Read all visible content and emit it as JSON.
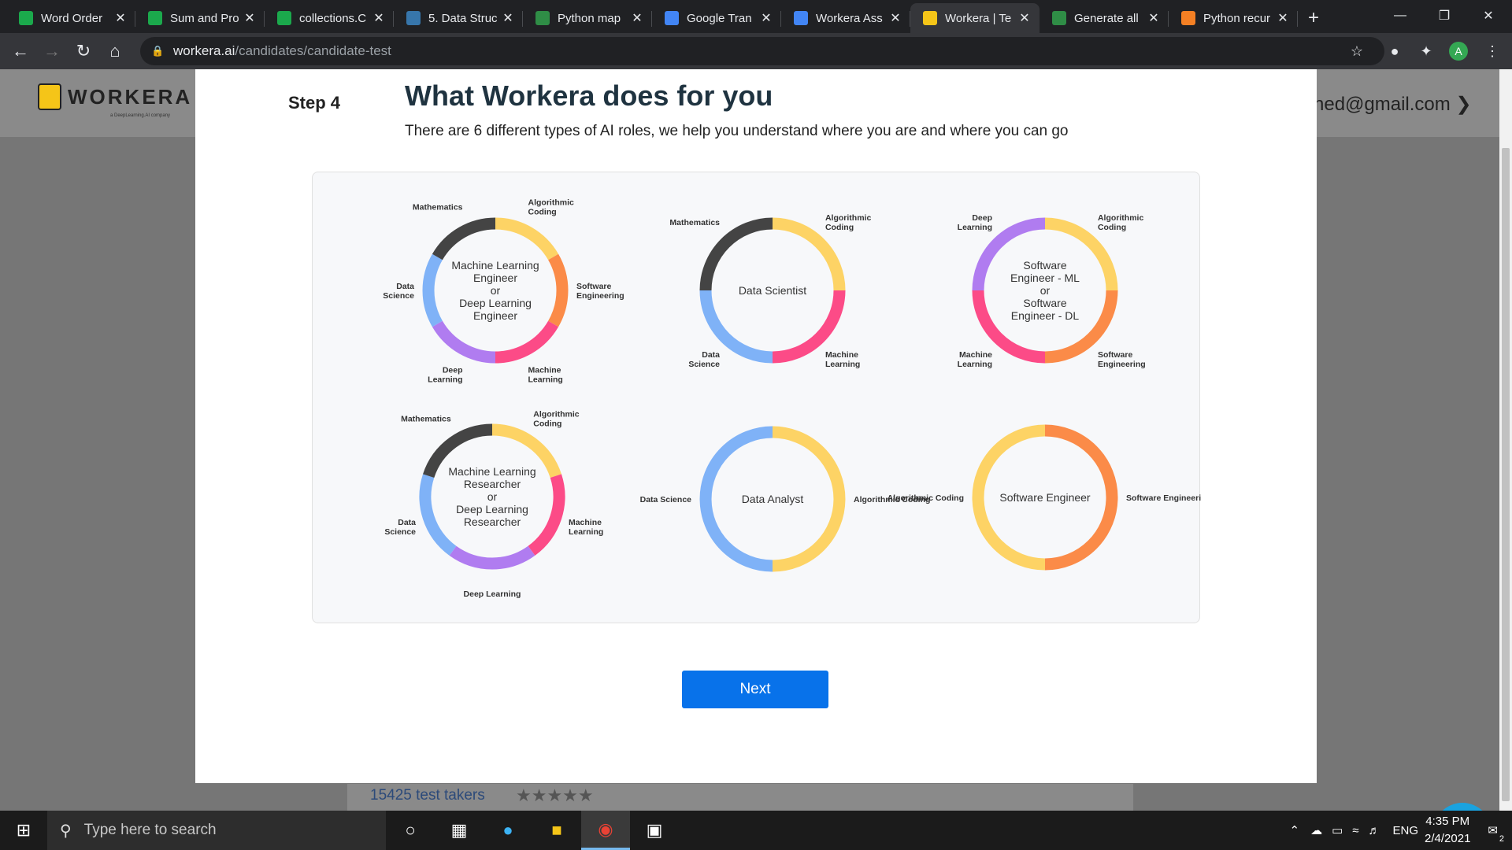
{
  "browser": {
    "tabs": [
      {
        "title": "Word Order",
        "fav": "hackerrank-icon",
        "color": "#1ba94c"
      },
      {
        "title": "Sum and Pro",
        "fav": "hackerrank-icon",
        "color": "#1ba94c"
      },
      {
        "title": "collections.C",
        "fav": "hackerrank-icon",
        "color": "#1ba94c"
      },
      {
        "title": "5. Data Struc",
        "fav": "python-icon",
        "color": "#3776ab"
      },
      {
        "title": "Python map",
        "fav": "geeksforgeeks-icon",
        "color": "#2f8d46"
      },
      {
        "title": "Google Tran",
        "fav": "google-translate-icon",
        "color": "#4285f4"
      },
      {
        "title": "Workera Ass",
        "fav": "docs-icon",
        "color": "#4285f4"
      },
      {
        "title": "Workera | Te",
        "fav": "workera-icon",
        "color": "#f5c518"
      },
      {
        "title": "Generate all",
        "fav": "geeksforgeeks-icon",
        "color": "#2f8d46"
      },
      {
        "title": "Python recur",
        "fav": "stackoverflow-icon",
        "color": "#f48024"
      }
    ],
    "active_tab": 7,
    "url_host": "workera.ai",
    "url_path": "/candidates/candidate-test",
    "profile_initial": "A"
  },
  "background": {
    "logo_text": "WORKERA",
    "logo_sub": "a DeepLearning.AI company",
    "email_fragment": "ned@gmail.com",
    "test_takers": "15425 test takers",
    "stars": "★★★★★"
  },
  "modal": {
    "step": "Step 4",
    "title": "What Workera does for you",
    "subtitle": "There are 6 different types of AI roles, we help you understand where you are and where you can go",
    "next_label": "Next"
  },
  "roles": [
    {
      "center": [
        "Machine Learning",
        "Engineer",
        "or",
        "Deep Learning",
        "Engineer"
      ],
      "segments": [
        {
          "label": "Algorithmic Coding",
          "color": "#fdd365"
        },
        {
          "label": "Software Engineering",
          "color": "#fb8b48"
        },
        {
          "label": "Machine Learning",
          "color": "#fc4b87"
        },
        {
          "label": "Deep Learning",
          "color": "#b07cf0"
        },
        {
          "label": "Data Science",
          "color": "#7fb2f7"
        },
        {
          "label": "Mathematics",
          "color": "#444444"
        }
      ]
    },
    {
      "center": [
        "Data Scientist"
      ],
      "segments": [
        {
          "label": "Algorithmic Coding",
          "color": "#fdd365"
        },
        {
          "label": "Machine Learning",
          "color": "#fc4b87"
        },
        {
          "label": "Data Science",
          "color": "#7fb2f7"
        },
        {
          "label": "Mathematics",
          "color": "#444444"
        }
      ]
    },
    {
      "center": [
        "Software",
        "Engineer - ML",
        "or",
        "Software",
        "Engineer - DL"
      ],
      "segments": [
        {
          "label": "Algorithmic Coding",
          "color": "#fdd365"
        },
        {
          "label": "Software Engineering",
          "color": "#fb8b48"
        },
        {
          "label": "Machine Learning",
          "color": "#fc4b87"
        },
        {
          "label": "Deep Learning",
          "color": "#b07cf0"
        }
      ]
    },
    {
      "center": [
        "Machine Learning",
        "Researcher",
        "or",
        "Deep Learning",
        "Researcher"
      ],
      "segments": [
        {
          "label": "Algorithmic Coding",
          "color": "#fdd365"
        },
        {
          "label": "Machine Learning",
          "color": "#fc4b87"
        },
        {
          "label": "Deep Learning",
          "color": "#b07cf0"
        },
        {
          "label": "Data Science",
          "color": "#7fb2f7"
        },
        {
          "label": "Mathematics",
          "color": "#444444"
        }
      ]
    },
    {
      "center": [
        "Data Analyst"
      ],
      "segments": [
        {
          "label": "Algorithmic Coding",
          "color": "#fdd365"
        },
        {
          "label": "Data Science",
          "color": "#7fb2f7"
        }
      ]
    },
    {
      "center": [
        "Software Engineer"
      ],
      "segments": [
        {
          "label": "Software Engineering",
          "color": "#fb8b48"
        },
        {
          "label": "Algorithmic Coding",
          "color": "#fdd365"
        }
      ]
    }
  ],
  "taskbar": {
    "search_placeholder": "Type here to search",
    "lang": "ENG",
    "time": "4:35 PM",
    "date": "2/4/2021",
    "notif_count": "2"
  }
}
